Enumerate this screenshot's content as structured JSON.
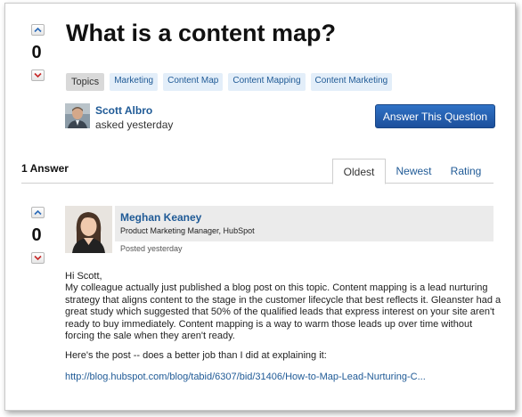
{
  "question": {
    "title": "What is a content map?",
    "votes": "0",
    "topics_label": "Topics",
    "tags": [
      "Marketing",
      "Content Map",
      "Content Mapping",
      "Content Marketing"
    ],
    "asker_name": "Scott Albro",
    "asker_meta": "asked yesterday",
    "answer_button_label": "Answer This Question"
  },
  "answers_section": {
    "count_label": "1 Answer",
    "tabs": [
      "Oldest",
      "Newest",
      "Rating"
    ],
    "active_tab": "Oldest"
  },
  "answer": {
    "votes": "0",
    "author_name": "Meghan Keaney",
    "author_title": "Product Marketing Manager, HubSpot",
    "posted": "Posted yesterday",
    "greeting": "Hi Scott,",
    "paragraph1": "My colleague actually just published a blog post on this topic. Content mapping is a lead nurturing strategy that aligns content to the stage in the customer lifecycle that best reflects it. Gleanster had a great study which suggested that 50% of the qualified leads that express interest on your site aren't ready to buy immediately. Content mapping is a way to warm those leads up over time without forcing the sale when they aren't ready.",
    "paragraph2": "Here's the post -- does a better job than I did at explaining it:",
    "link_text": "http://blog.hubspot.com/blog/tabid/6307/bid/31406/How-to-Map-Lead-Nurturing-C..."
  },
  "colors": {
    "link": "#1f5a96",
    "button": "#1c4f9b",
    "tag_bg": "#e3eef9",
    "header_bg": "#ebebeb"
  },
  "icons": [
    "chevron-up-icon",
    "chevron-down-icon"
  ]
}
